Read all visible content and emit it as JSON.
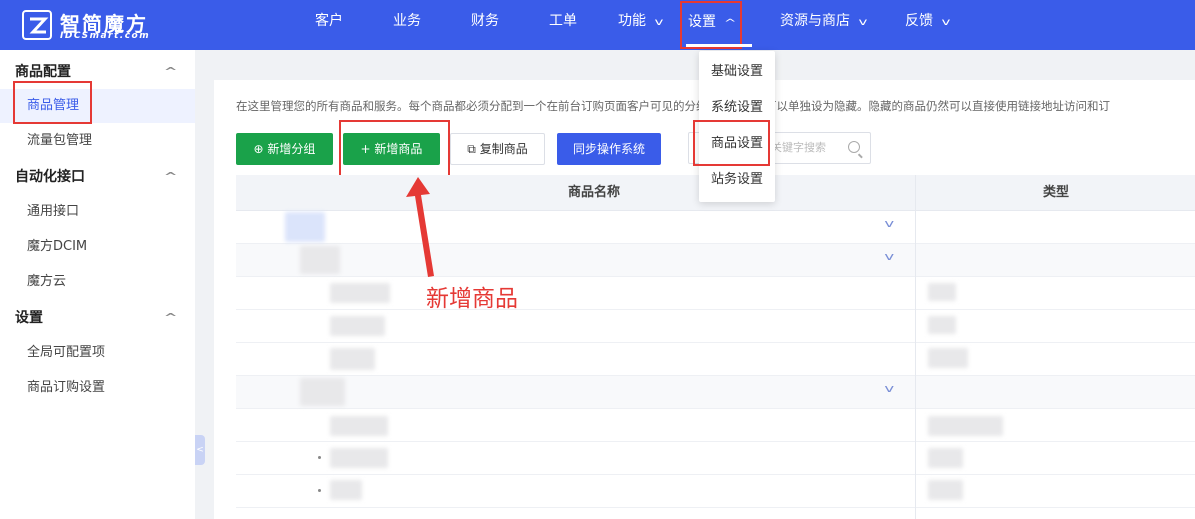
{
  "app": {
    "logo_cn": "智简魔方",
    "logo_en": "IDCSmart.com"
  },
  "nav": {
    "items": [
      {
        "label": "客户",
        "has_chevron": false
      },
      {
        "label": "业务",
        "has_chevron": false
      },
      {
        "label": "财务",
        "has_chevron": false
      },
      {
        "label": "工单",
        "has_chevron": false
      },
      {
        "label": "功能",
        "has_chevron": true
      },
      {
        "label": "设置",
        "has_chevron": true,
        "active": true
      },
      {
        "label": "资源与商店",
        "has_chevron": true
      },
      {
        "label": "反馈",
        "has_chevron": true
      }
    ]
  },
  "settings_dropdown": {
    "items": [
      "基础设置",
      "系统设置",
      "商品设置",
      "站务设置"
    ],
    "highlighted": "商品设置"
  },
  "sidebar": {
    "groups": [
      {
        "label": "商品配置",
        "items": [
          "商品管理",
          "流量包管理"
        ]
      },
      {
        "label": "自动化接口",
        "items": [
          "通用接口",
          "魔方DCIM",
          "魔方云"
        ]
      },
      {
        "label": "设置",
        "items": [
          "全局可配置项",
          "商品订购设置"
        ]
      }
    ],
    "active_item": "商品管理"
  },
  "main": {
    "description": "在这里管理您的所有商品和服务。每个商品都必须分配到一个在前台订购页面客户可见的分组中，商品也可以单独设为隐藏。隐藏的商品仍然可以直接使用链接地址访问和订",
    "buttons": {
      "add_group": "新增分组",
      "add_product": "新增商品",
      "copy_product": "复制商品",
      "sync_os": "同步操作系统"
    },
    "search_placeholder": "关键字搜索",
    "table": {
      "columns": [
        "商品名称",
        "类型"
      ]
    },
    "annotation": "新增商品"
  },
  "colors": {
    "topbar": "#3a5ce9",
    "green_button": "#1aa24a",
    "blue_button": "#3a5ce9",
    "highlight_red": "#e53935"
  }
}
